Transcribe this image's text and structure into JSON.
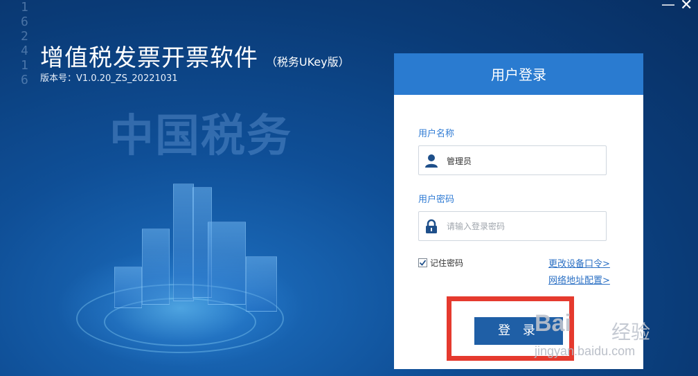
{
  "window": {
    "title": "增值税发票开票软件",
    "subtitle": "（税务UKey版）",
    "version": "版本号：V1.0.20_ZS_20221031",
    "minimize_label": "—",
    "close_label": "✕"
  },
  "background": {
    "watermark_text": "中国税务",
    "side_digits": "1\n6\n2\n4\n1\n6"
  },
  "login": {
    "header": "用户登录",
    "username_label": "用户名称",
    "username_value": "管理员",
    "password_label": "用户密码",
    "password_placeholder": "请输入登录密码",
    "remember_label": "记住密码",
    "remember_checked": true,
    "change_device_link": "更改设备口令>",
    "network_config_link": "网络地址配置>",
    "submit_label": "登 录"
  },
  "overlay": {
    "baidu_logo": "Bai",
    "baidu_cn": "经验",
    "baidu_url": "jingyan.baidu.com"
  },
  "colors": {
    "header_blue": "#2a7bd0",
    "button_blue": "#1f5fa6",
    "link_blue": "#2a6fc4",
    "highlight_red": "#e53a2e"
  }
}
